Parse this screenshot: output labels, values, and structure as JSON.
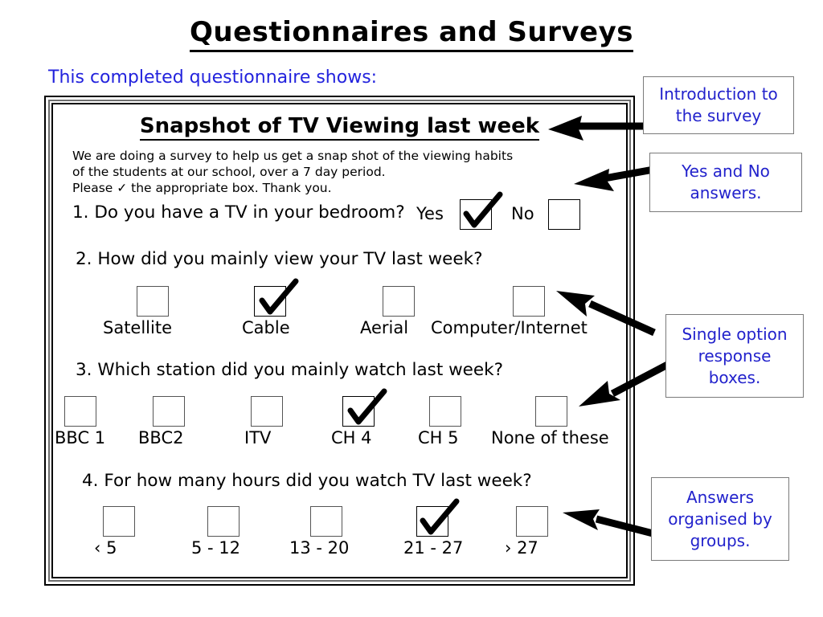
{
  "page": {
    "title": "Questionnaires and Surveys",
    "subtitle": "This completed questionnaire shows:"
  },
  "questionnaire": {
    "title": "Snapshot of TV Viewing last week",
    "intro_line1": "We are doing a survey to help us get a snap shot of the viewing habits",
    "intro_line2": "of the students at our school, over a 7 day period.",
    "intro_line3": "Please ✓ the appropriate box. Thank you.",
    "questions": [
      {
        "number": "1.",
        "text": "1. Do you have a TV in your bedroom?",
        "yes_label": "Yes",
        "no_label": "No",
        "options": [
          {
            "label": "Yes",
            "checked": true
          },
          {
            "label": "No",
            "checked": false
          }
        ]
      },
      {
        "number": "2.",
        "text": "2. How did you mainly view your TV last week?",
        "options": [
          {
            "label": "Satellite",
            "checked": false
          },
          {
            "label": "Cable",
            "checked": true
          },
          {
            "label": "Aerial",
            "checked": false
          },
          {
            "label": "Computer/Internet",
            "checked": false
          }
        ]
      },
      {
        "number": "3.",
        "text": "3. Which station did you mainly watch last week?",
        "options": [
          {
            "label": "BBC 1",
            "checked": false
          },
          {
            "label": "BBC2",
            "checked": false
          },
          {
            "label": "ITV",
            "checked": false
          },
          {
            "label": "CH 4",
            "checked": true
          },
          {
            "label": "CH 5",
            "checked": false
          },
          {
            "label": "None of these",
            "checked": false
          }
        ]
      },
      {
        "number": "4.",
        "text": "4. For how many hours did you watch TV last week?",
        "options": [
          {
            "label": "‹ 5",
            "checked": false
          },
          {
            "label": "5 - 12",
            "checked": false
          },
          {
            "label": "13 - 20",
            "checked": false
          },
          {
            "label": "21 - 27",
            "checked": true
          },
          {
            "label": "› 27",
            "checked": false
          }
        ]
      }
    ]
  },
  "callouts": [
    {
      "line1": "Introduction",
      "line2": "to the survey",
      "text": "Introduction to the survey"
    },
    {
      "line1": "Yes and No",
      "line2": "answers.",
      "text": "Yes and No answers."
    },
    {
      "line1": "Single option",
      "line2": "response",
      "line3": "boxes.",
      "text": "Single option response boxes."
    },
    {
      "line1": "Answers",
      "line2": "organised by",
      "line3": "groups.",
      "text": "Answers organised by groups."
    }
  ],
  "colors": {
    "annotation_blue": "#2222cc",
    "title_black": "#000000",
    "frame_gray": "#6e6e6e",
    "checkbox_border": "#555555"
  }
}
